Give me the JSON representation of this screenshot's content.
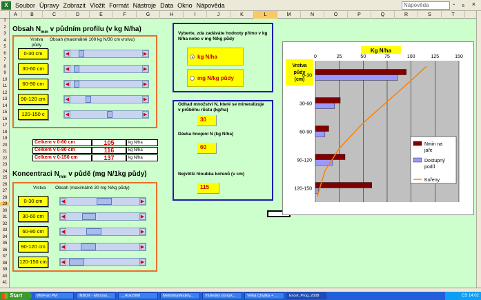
{
  "menu": {
    "items": [
      "Soubor",
      "Úpravy",
      "Zobrazit",
      "Vložit",
      "Formát",
      "Nástroje",
      "Data",
      "Okno",
      "Nápověda"
    ],
    "help_placeholder": "Nápověda",
    "window_controls": "- ₅ ×"
  },
  "columns": [
    "A",
    "B",
    "C",
    "D",
    "E",
    "F",
    "G",
    "H",
    "I",
    "J",
    "K",
    "L",
    "M",
    "N",
    "O",
    "P",
    "Q",
    "R",
    "S",
    "T"
  ],
  "rows": [
    "1",
    "2",
    "3",
    "4",
    "5",
    "6",
    "7",
    "8",
    "9",
    "10",
    "11",
    "12",
    "13",
    "14",
    "15",
    "16",
    "17",
    "18",
    "19",
    "20",
    "21",
    "22",
    "23",
    "24",
    "25",
    "26",
    "27",
    "28",
    "29",
    "30",
    "31",
    "32",
    "33",
    "34",
    "35",
    "36",
    "37",
    "38",
    "39",
    "40",
    "41"
  ],
  "section1": {
    "title_pre": "Obsah N",
    "title_sub": "min",
    "title_post": " v půdním profilu (v kg N/ha)",
    "col1": "Vrstva",
    "col1b": "půdy",
    "col2": "Obsah (maximálně 100 kg N/30 cm vrstvu)",
    "layers": [
      "0-30 cm",
      "30-60 cm",
      "60-90 cm",
      "90-120 cm",
      "120-150 c"
    ],
    "levels": [
      0.13,
      0.05,
      0.05,
      0.23,
      0.55
    ]
  },
  "totals": [
    {
      "label": "Celkem v 0-60 cm",
      "value": "105",
      "unit": "kg N/ha"
    },
    {
      "label": "Celkem v 0-90 cm",
      "value": "116",
      "unit": "kg N/ha"
    },
    {
      "label": "Celkem v 0-150 cm",
      "value": "137",
      "unit": "kg N/ha"
    }
  ],
  "section2": {
    "title_pre": "Koncentraci N",
    "title_sub": "min",
    "title_post": " v půdě (mg N/1kg půdy)",
    "col1": "Vrstva",
    "col2": "Obsah (maximálně 30 mg N/kg půdy)",
    "layers": [
      "0-30 cm",
      "30-60 cm",
      "60-90 cm",
      "90-120 cm",
      "120-150 cm"
    ],
    "levels": [
      0.52,
      0.27,
      0.35,
      0.25,
      0.05
    ]
  },
  "unit_select": {
    "title": "Vyberte, zda zadáváte hodnoty přímo v kg N/ha nebo v mg N/kg půdy",
    "opt1": "kg N/ha",
    "opt2": "mg N/kg půdy",
    "selected": 1
  },
  "inputs": {
    "mineral_label": "Odhad množství N, které se mineralizuje v průběhu růstu (kg/ha)",
    "mineral_value": "30",
    "dose_label": "Dávka hnojení N (kg N/ha)",
    "dose_value": "60",
    "depth_label": "Největší hloubka kořenů (v cm)",
    "depth_value": "115"
  },
  "chart_data": {
    "type": "bar",
    "orientation": "horizontal",
    "title": "Kg N/ha",
    "ylabel": "Vrstva půdy (cm)",
    "categories": [
      "0-30",
      "30-60",
      "60-90",
      "90-120",
      "120-150"
    ],
    "xlim": [
      0,
      150
    ],
    "xticks": [
      "0",
      "25",
      "50",
      "75",
      "100",
      "125",
      "150"
    ],
    "series": [
      {
        "name": "Nmin na jaře",
        "color": "#800000",
        "values": [
          95,
          26,
          14,
          31,
          59
        ]
      },
      {
        "name": "Dostupný podíl",
        "color": "#9999ff",
        "values": [
          86,
          20,
          10,
          18,
          3
        ]
      }
    ],
    "line": {
      "name": "Kořeny",
      "color": "#ff8000",
      "x": [
        2,
        10,
        25,
        50,
        75,
        100,
        116
      ],
      "y": [
        0.96,
        0.78,
        0.62,
        0.44,
        0.29,
        0.14,
        0.04
      ]
    },
    "legend": "right",
    "grid": true
  },
  "taskbar": {
    "start": "Start",
    "tasks": [
      "WinFast PM",
      "INBOX - Microso...",
      "__Rok2008",
      "MetodikaModely...",
      "Výsledky obrázk...",
      "Velká Chyška + ...",
      "Excel_Prog_2008"
    ],
    "tray": "CS  14:02"
  }
}
